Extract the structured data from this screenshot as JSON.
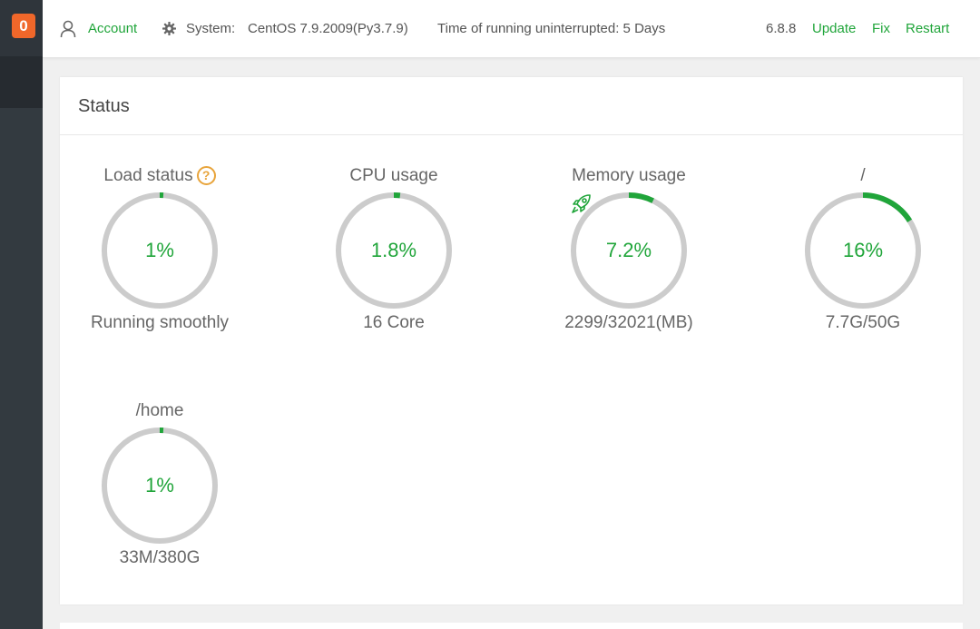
{
  "sidebar": {
    "badge": "0"
  },
  "topbar": {
    "account": "Account",
    "system_label": "System:",
    "system_value": "CentOS 7.9.2009(Py3.7.9)",
    "uptime": "Time of running uninterrupted: 5 Days",
    "version": "6.8.8",
    "update": "Update",
    "fix": "Fix",
    "restart": "Restart"
  },
  "status": {
    "title": "Status",
    "gauges": [
      {
        "label": "Load status",
        "value": "1%",
        "percent": 1,
        "sub": "Running smoothly",
        "help_icon": "question-icon"
      },
      {
        "label": "CPU usage",
        "value": "1.8%",
        "percent": 1.8,
        "sub": "16 Core"
      },
      {
        "label": "Memory usage",
        "value": "7.2%",
        "percent": 7.2,
        "sub": "2299/32021(MB)",
        "icon": "rocket-icon"
      },
      {
        "label": "/",
        "value": "16%",
        "percent": 16,
        "sub": "7.7G/50G"
      },
      {
        "label": "/home",
        "value": "1%",
        "percent": 1,
        "sub": "33M/380G"
      }
    ]
  },
  "colors": {
    "accent": "#20a53a",
    "ring": "#cccccc",
    "badge": "#f0672a",
    "help": "#e8a43b"
  }
}
